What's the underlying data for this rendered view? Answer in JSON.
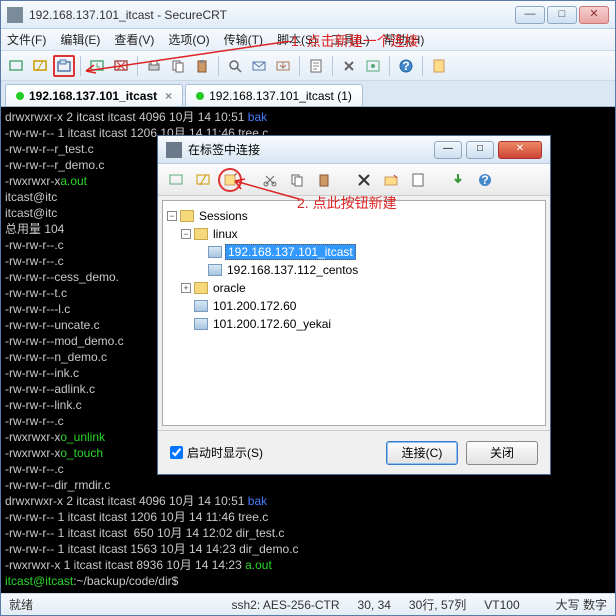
{
  "window": {
    "title": "192.168.137.101_itcast - SecureCRT"
  },
  "menu": {
    "file": "文件(F)",
    "edit": "编辑(E)",
    "view": "查看(V)",
    "options": "选项(O)",
    "transfer": "传输(T)",
    "script": "脚本(S)",
    "tools": "工具(L)",
    "help": "帮助(H)"
  },
  "tabs": {
    "t1": "192.168.137.101_itcast",
    "t2": "192.168.137.101_itcast (1)"
  },
  "terminal": {
    "lines": [
      {
        "p": "drwxrwxr-x 2 itcast itcast 4096 10月 14 10:51 ",
        "n": "bak",
        "c": "bl"
      },
      {
        "p": "-rw-rw-r-- 1 itcast itcast 1206 10月 14 11:46 ",
        "n": "tree.c",
        "c": "wh"
      },
      {
        "p": "-rw-rw-r--",
        "n": "r_test.c",
        "c": "wh"
      },
      {
        "p": "-rw-rw-r--",
        "n": "r_demo.c",
        "c": "wh"
      },
      {
        "p": "-rwxrwxr-x",
        "n": "a.out",
        "c": "gr"
      },
      {
        "p": "itcast@itc",
        "n": "",
        "c": "wh"
      },
      {
        "p": "itcast@itc",
        "n": "",
        "c": "wh"
      },
      {
        "p": "总用量 104",
        "n": "",
        "c": "wh"
      },
      {
        "p": "-rw-rw-r--",
        "n": ".c",
        "c": "wh"
      },
      {
        "p": "-rw-rw-r--",
        "n": ".c",
        "c": "wh"
      },
      {
        "p": "-rw-rw-r--",
        "n": "cess_demo.",
        "c": "wh"
      },
      {
        "p": "-rw-rw-r--",
        "n": "t.c",
        "c": "wh"
      },
      {
        "p": "-rw-rw-r--",
        "n": "-l.c",
        "c": "wh"
      },
      {
        "p": "-rw-rw-r--",
        "n": "uncate.c",
        "c": "wh"
      },
      {
        "p": "-rw-rw-r--",
        "n": "mod_demo.c",
        "c": "wh"
      },
      {
        "p": "-rw-rw-r--",
        "n": "n_demo.c",
        "c": "wh"
      },
      {
        "p": "-rw-rw-r--",
        "n": "ink.c",
        "c": "wh"
      },
      {
        "p": "-rw-rw-r--",
        "n": "adlink.c",
        "c": "wh"
      },
      {
        "p": "-rw-rw-r--",
        "n": "link.c",
        "c": "wh"
      },
      {
        "p": "-rw-rw-r--",
        "n": ".c",
        "c": "wh"
      },
      {
        "p": "-rwxrwxr-x",
        "n": "o_unlink",
        "c": "gr"
      },
      {
        "p": "-rwxrwxr-x",
        "n": "o_touch",
        "c": "gr"
      },
      {
        "p": "-rw-rw-r--",
        "n": ".c",
        "c": "wh"
      },
      {
        "p": "-rw-rw-r--",
        "n": "dir_rmdir.c",
        "c": "wh"
      },
      {
        "p": "drwxrwxr-x 2 itcast itcast 4096 10月 14 10:51 ",
        "n": "bak",
        "c": "bl"
      },
      {
        "p": "-rw-rw-r-- 1 itcast itcast 1206 10月 14 11:46 ",
        "n": "tree.c",
        "c": "wh"
      },
      {
        "p": "-rw-rw-r-- 1 itcast itcast  650 10月 14 12:02 ",
        "n": "dir_test.c",
        "c": "wh"
      },
      {
        "p": "-rw-rw-r-- 1 itcast itcast 1563 10月 14 14:23 ",
        "n": "dir_demo.c",
        "c": "wh"
      },
      {
        "p": "-rwxrwxr-x 1 itcast itcast 8936 10月 14 14:23 ",
        "n": "a.out",
        "c": "gr"
      }
    ],
    "prompt_user": "itcast@itcast",
    "prompt_path": ":~/backup/code/dir",
    "prompt_end": "$"
  },
  "dialog": {
    "title": "在标签中连接",
    "tree": {
      "root": "Sessions",
      "linux": "linux",
      "s1": "192.168.137.101_itcast",
      "s2": "192.168.137.112_centos",
      "oracle": "oracle",
      "s3": "101.200.172.60",
      "s4": "101.200.172.60_yekai"
    },
    "show_on_start": "启动时显示(S)",
    "connect": "连接(C)",
    "close": "关闭"
  },
  "status": {
    "ready": "就绪",
    "ssh": "ssh2: AES-256-CTR",
    "pos": "30, 34",
    "size": "30行, 57列",
    "vt": "VT100",
    "caps": "大写 数字"
  },
  "annotations": {
    "a1": "1. 点击新建一个连接",
    "a2": "2. 点此按钮新建"
  }
}
